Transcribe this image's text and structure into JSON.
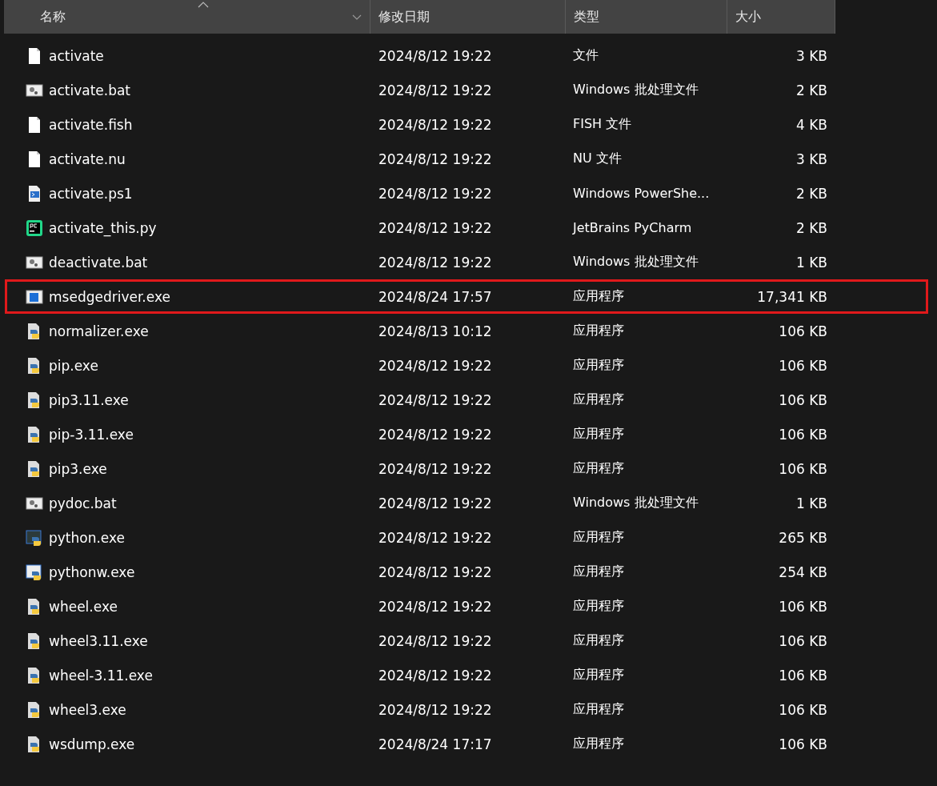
{
  "columns": [
    {
      "label": "名称",
      "sorted": true,
      "filter": true
    },
    {
      "label": "修改日期",
      "sorted": false,
      "filter": false
    },
    {
      "label": "类型",
      "sorted": false,
      "filter": false
    },
    {
      "label": "大小",
      "sorted": false,
      "filter": false
    }
  ],
  "rows": [
    {
      "kind": "file",
      "name": "activate",
      "date": "2024/8/12 19:22",
      "type": "文件",
      "size": "3 KB",
      "highlighted": false
    },
    {
      "kind": "bat",
      "name": "activate.bat",
      "date": "2024/8/12 19:22",
      "type": "Windows 批处理文件",
      "size": "2 KB",
      "highlighted": false
    },
    {
      "kind": "file",
      "name": "activate.fish",
      "date": "2024/8/12 19:22",
      "type": "FISH 文件",
      "size": "4 KB",
      "highlighted": false
    },
    {
      "kind": "file",
      "name": "activate.nu",
      "date": "2024/8/12 19:22",
      "type": "NU 文件",
      "size": "3 KB",
      "highlighted": false
    },
    {
      "kind": "ps1",
      "name": "activate.ps1",
      "date": "2024/8/12 19:22",
      "type": "Windows PowerShe...",
      "size": "2 KB",
      "highlighted": false
    },
    {
      "kind": "pycharm",
      "name": "activate_this.py",
      "date": "2024/8/12 19:22",
      "type": "JetBrains PyCharm",
      "size": "2 KB",
      "highlighted": false
    },
    {
      "kind": "bat",
      "name": "deactivate.bat",
      "date": "2024/8/12 19:22",
      "type": "Windows 批处理文件",
      "size": "1 KB",
      "highlighted": false
    },
    {
      "kind": "exe",
      "name": "msedgedriver.exe",
      "date": "2024/8/24 17:57",
      "type": "应用程序",
      "size": "17,341 KB",
      "highlighted": true
    },
    {
      "kind": "pyexe",
      "name": "normalizer.exe",
      "date": "2024/8/13 10:12",
      "type": "应用程序",
      "size": "106 KB",
      "highlighted": false
    },
    {
      "kind": "pyexe",
      "name": "pip.exe",
      "date": "2024/8/12 19:22",
      "type": "应用程序",
      "size": "106 KB",
      "highlighted": false
    },
    {
      "kind": "pyexe",
      "name": "pip3.11.exe",
      "date": "2024/8/12 19:22",
      "type": "应用程序",
      "size": "106 KB",
      "highlighted": false
    },
    {
      "kind": "pyexe",
      "name": "pip-3.11.exe",
      "date": "2024/8/12 19:22",
      "type": "应用程序",
      "size": "106 KB",
      "highlighted": false
    },
    {
      "kind": "pyexe",
      "name": "pip3.exe",
      "date": "2024/8/12 19:22",
      "type": "应用程序",
      "size": "106 KB",
      "highlighted": false
    },
    {
      "kind": "bat",
      "name": "pydoc.bat",
      "date": "2024/8/12 19:22",
      "type": "Windows 批处理文件",
      "size": "1 KB",
      "highlighted": false
    },
    {
      "kind": "python",
      "name": "python.exe",
      "date": "2024/8/12 19:22",
      "type": "应用程序",
      "size": "265 KB",
      "highlighted": false
    },
    {
      "kind": "pythonw",
      "name": "pythonw.exe",
      "date": "2024/8/12 19:22",
      "type": "应用程序",
      "size": "254 KB",
      "highlighted": false
    },
    {
      "kind": "pyexe",
      "name": "wheel.exe",
      "date": "2024/8/12 19:22",
      "type": "应用程序",
      "size": "106 KB",
      "highlighted": false
    },
    {
      "kind": "pyexe",
      "name": "wheel3.11.exe",
      "date": "2024/8/12 19:22",
      "type": "应用程序",
      "size": "106 KB",
      "highlighted": false
    },
    {
      "kind": "pyexe",
      "name": "wheel-3.11.exe",
      "date": "2024/8/12 19:22",
      "type": "应用程序",
      "size": "106 KB",
      "highlighted": false
    },
    {
      "kind": "pyexe",
      "name": "wheel3.exe",
      "date": "2024/8/12 19:22",
      "type": "应用程序",
      "size": "106 KB",
      "highlighted": false
    },
    {
      "kind": "pyexe",
      "name": "wsdump.exe",
      "date": "2024/8/24 17:17",
      "type": "应用程序",
      "size": "106 KB",
      "highlighted": false
    }
  ]
}
